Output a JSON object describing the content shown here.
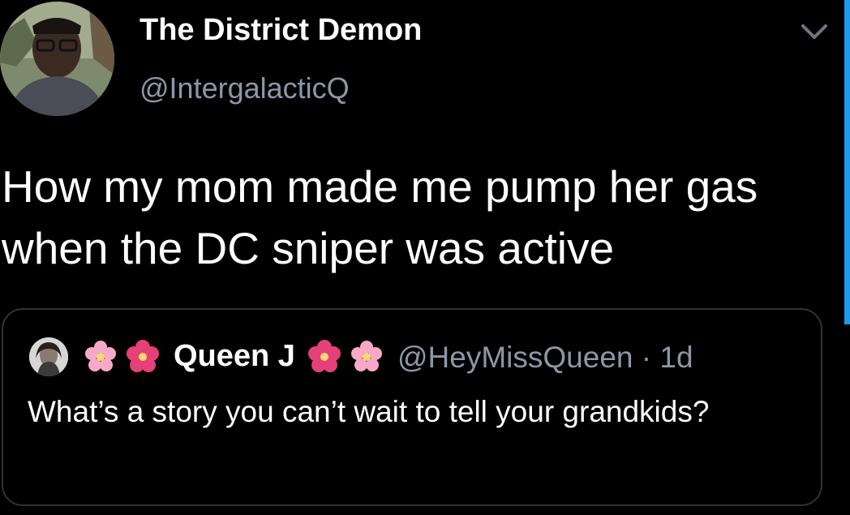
{
  "tweet": {
    "display_name": "The District Demon",
    "handle": "@IntergalacticQ",
    "text": "How my mom made me pump her gas when the DC sniper was active",
    "avatar_icon": "profile-photo",
    "menu_icon": "chevron-down-icon"
  },
  "quoted_tweet": {
    "display_name": "Queen J",
    "handle_time": "@HeyMissQueen · 1d",
    "text": "What’s a story you can’t wait to tell your grandkids?",
    "avatar_icon": "profile-photo",
    "name_decorations": [
      "cherry-blossom-icon",
      "hibiscus-icon",
      "hibiscus-icon",
      "cherry-blossom-icon"
    ]
  },
  "colors": {
    "background": "#000000",
    "primary_text": "#ffffff",
    "secondary_text": "#8b98a5",
    "card_border": "#2f3336",
    "accent": "#1d9bf0",
    "cherry_blossom": "#f7a8c8",
    "hibiscus": "#e5407a"
  }
}
